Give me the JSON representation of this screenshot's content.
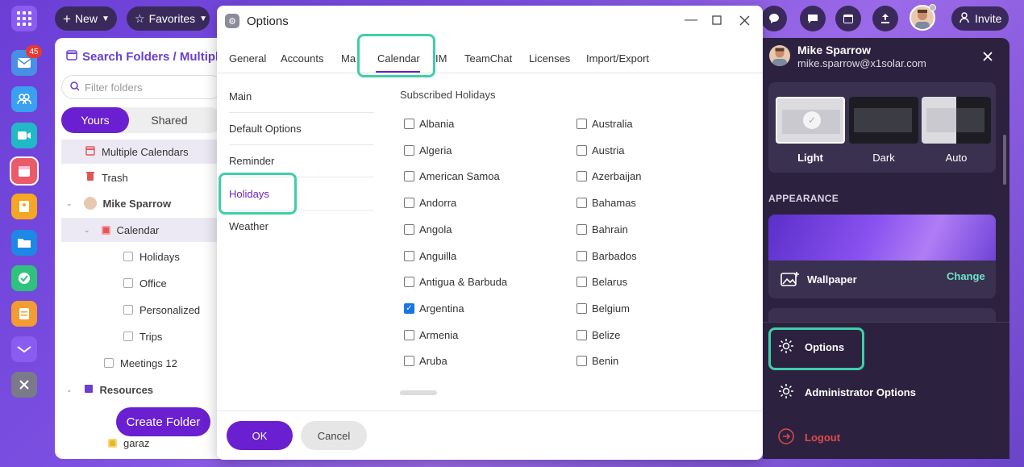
{
  "topbar": {
    "new_label": "New",
    "favorites_label": "Favorites",
    "invite_label": "Invite"
  },
  "rail": {
    "mail_badge": "45"
  },
  "folders": {
    "title": "Search Folders / Multiple",
    "filter_placeholder": "Filter folders",
    "seg_yours": "Yours",
    "seg_shared": "Shared",
    "rows": [
      {
        "label": "Multiple Calendars"
      },
      {
        "label": "Trash"
      },
      {
        "label": "Mike Sparrow"
      },
      {
        "label": "Calendar"
      },
      {
        "label": "Holidays"
      },
      {
        "label": "Office"
      },
      {
        "label": "Personalized"
      },
      {
        "label": "Trips"
      },
      {
        "label": "Meetings 12"
      },
      {
        "label": "Resources"
      },
      {
        "label": "garaz"
      }
    ],
    "create_folder": "Create Folder"
  },
  "dialog": {
    "title": "Options",
    "tabs": [
      "General",
      "Accounts",
      "Ma",
      "Calendar",
      "IM",
      "TeamChat",
      "Licenses",
      "Import/Export"
    ],
    "active_tab": "Calendar",
    "side": [
      "Main",
      "Default Options",
      "Reminder",
      "Holidays",
      "Weather"
    ],
    "active_side": "Holidays",
    "subscribed_title": "Subscribed Holidays",
    "col1": [
      {
        "name": "Albania",
        "checked": false
      },
      {
        "name": "Algeria",
        "checked": false
      },
      {
        "name": "American Samoa",
        "checked": false
      },
      {
        "name": "Andorra",
        "checked": false
      },
      {
        "name": "Angola",
        "checked": false
      },
      {
        "name": "Anguilla",
        "checked": false
      },
      {
        "name": "Antigua & Barbuda",
        "checked": false
      },
      {
        "name": "Argentina",
        "checked": true
      },
      {
        "name": "Armenia",
        "checked": false
      },
      {
        "name": "Aruba",
        "checked": false
      }
    ],
    "col2": [
      {
        "name": "Australia",
        "checked": false
      },
      {
        "name": "Austria",
        "checked": false
      },
      {
        "name": "Azerbaijan",
        "checked": false
      },
      {
        "name": "Bahamas",
        "checked": false
      },
      {
        "name": "Bahrain",
        "checked": false
      },
      {
        "name": "Barbados",
        "checked": false
      },
      {
        "name": "Belarus",
        "checked": false
      },
      {
        "name": "Belgium",
        "checked": false
      },
      {
        "name": "Belize",
        "checked": false
      },
      {
        "name": "Benin",
        "checked": false
      }
    ],
    "ok_label": "OK",
    "cancel_label": "Cancel"
  },
  "user_panel": {
    "name": "Mike Sparrow",
    "email": "mike.sparrow@x1solar.com",
    "themes": [
      "Light",
      "Dark",
      "Auto"
    ],
    "appearance_heading": "APPEARANCE",
    "wallpaper_label": "Wallpaper",
    "change_label": "Change",
    "menu": [
      "Options",
      "Administrator Options",
      "Logout"
    ]
  },
  "colors": {
    "accent": "#6a1fd0",
    "highlight": "#3ecfa9",
    "logout": "#e04a4a"
  }
}
